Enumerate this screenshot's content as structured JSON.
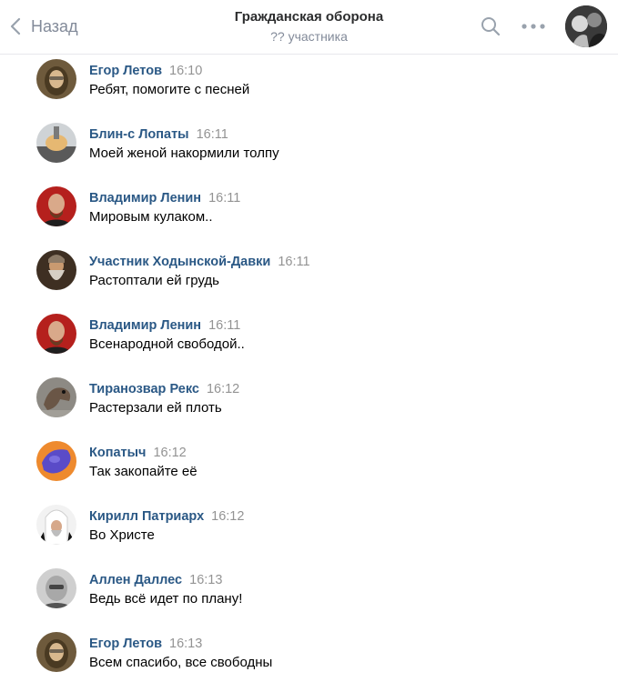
{
  "header": {
    "back_label": "Назад",
    "title": "Гражданская оборона",
    "subtitle": "?? участника",
    "icons": {
      "back": "chevron-left-icon",
      "search": "search-icon",
      "more": "more-icon"
    },
    "colors": {
      "muted": "#828a99",
      "title": "#2c2d2e"
    }
  },
  "colors": {
    "author": "#2a5885",
    "time": "#939393",
    "text": "#000000"
  },
  "messages": [
    {
      "author": "Егор Летов",
      "time": "16:10",
      "text": "Ребят, помогите с песней"
    },
    {
      "author": "Блин-с Лопаты",
      "time": "16:11",
      "text": "Моей женой накормили толпу"
    },
    {
      "author": "Владимир Ленин",
      "time": "16:11",
      "text": "Мировым кулаком.."
    },
    {
      "author": "Участник Ходынской-Давки",
      "time": "16:11",
      "text": "Растоптали ей грудь"
    },
    {
      "author": "Владимир Ленин",
      "time": "16:11",
      "text": "Всенародной свободой.."
    },
    {
      "author": "Тиранозвар Рекс",
      "time": "16:12",
      "text": "Растерзали ей плоть"
    },
    {
      "author": "Копатыч",
      "time": "16:12",
      "text": "Так закопайте её"
    },
    {
      "author": "Кирилл Патриарх",
      "time": "16:12",
      "text": "Во Христе"
    },
    {
      "author": "Аллен Даллес",
      "time": "16:13",
      "text": "Ведь всё идет по плану!"
    },
    {
      "author": "Егор Летов",
      "time": "16:13",
      "text": "Всем спасибо, все свободны"
    }
  ]
}
